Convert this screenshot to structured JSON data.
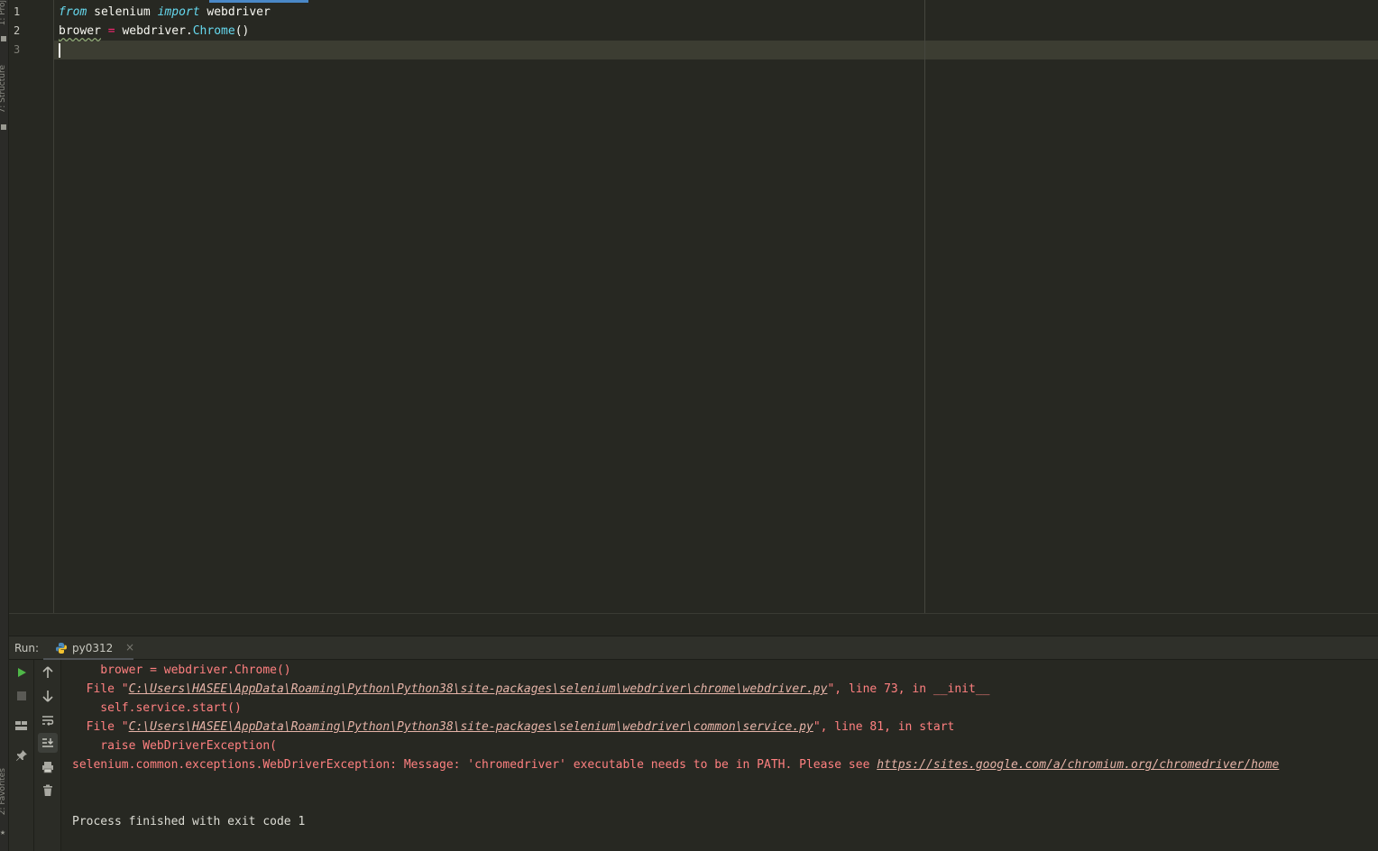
{
  "sidebar": {
    "project_label": "1: Proj",
    "structure_label": "7: Structure",
    "favorites_label": "2: Favorites"
  },
  "editor": {
    "line_numbers": [
      "1",
      "2",
      "3"
    ],
    "line1": {
      "kw_from": "from",
      "module": "selenium",
      "kw_import": "import",
      "name": "webdriver"
    },
    "line2": {
      "var": "brower",
      "op": "=",
      "obj": "webdriver.",
      "cls": "Chrome",
      "call": "()"
    }
  },
  "run": {
    "label": "Run:",
    "tab_name": "py0312",
    "close_glyph": "×"
  },
  "console": {
    "lines": [
      {
        "pre": "    brower = webdriver.Chrome()"
      },
      {
        "pre": "  File \"",
        "link": "C:\\Users\\HASEE\\AppData\\Roaming\\Python\\Python38\\site-packages\\selenium\\webdriver\\chrome\\webdriver.py",
        "post": "\", line 73, in __init__"
      },
      {
        "pre": "    self.service.start()"
      },
      {
        "pre": "  File \"",
        "link": "C:\\Users\\HASEE\\AppData\\Roaming\\Python\\Python38\\site-packages\\selenium\\webdriver\\common\\service.py",
        "post": "\", line 81, in start"
      },
      {
        "pre": "    raise WebDriverException("
      },
      {
        "pre": "selenium.common.exceptions.WebDriverException: Message: 'chromedriver' executable needs to be in PATH. Please see ",
        "link": "https://sites.google.com/a/chromium.org/chromedriver/home"
      }
    ],
    "exit_message": "Process finished with exit code 1"
  },
  "icons": [
    "run-icon",
    "stop-icon",
    "layout-icon",
    "pin-icon",
    "arrow-up-icon",
    "arrow-down-icon",
    "soft-wrap-icon",
    "scroll-to-end-icon",
    "print-icon",
    "trash-icon",
    "python-icon",
    "close-icon"
  ],
  "colors": {
    "keyword": "#66d9ef",
    "operator": "#f92672",
    "error_text": "#ff8080",
    "background": "#272822"
  }
}
